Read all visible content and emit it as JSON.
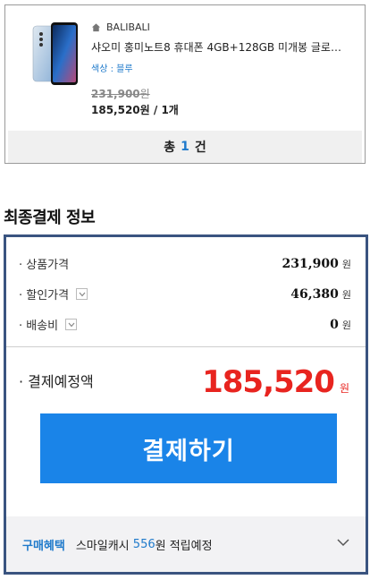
{
  "product": {
    "shop_name": "BALIBALI",
    "title": "샤오미 홍미노트8 휴대폰 4GB+128GB 미개봉 글로…",
    "option_label": "색상 : 블루",
    "original_price": "231,900",
    "original_unit": "원",
    "sale_price": "185,520원",
    "separator": " / ",
    "quantity": "1개"
  },
  "summary": {
    "prefix": "총",
    "count": "1",
    "suffix": "건"
  },
  "payment_info": {
    "section_title": "최종결제 정보",
    "rows": [
      {
        "label": "· 상품가격",
        "value": "231,900",
        "unit": "원"
      },
      {
        "label": "· 할인가격",
        "value": "46,380",
        "unit": "원"
      },
      {
        "label": "· 배송비",
        "value": "0",
        "unit": "원"
      }
    ],
    "final_label": "· 결제예정액",
    "final_amount": "185,520",
    "final_unit": "원",
    "pay_button_label": "결제하기",
    "benefit": {
      "label": "구매혜택",
      "prefix": "스마일캐시",
      "amount": "556",
      "suffix": "원 적립예정"
    }
  },
  "colors": {
    "accent_blue": "#1a84e8",
    "price_red": "#e8241f",
    "box_border": "#3a5480"
  }
}
